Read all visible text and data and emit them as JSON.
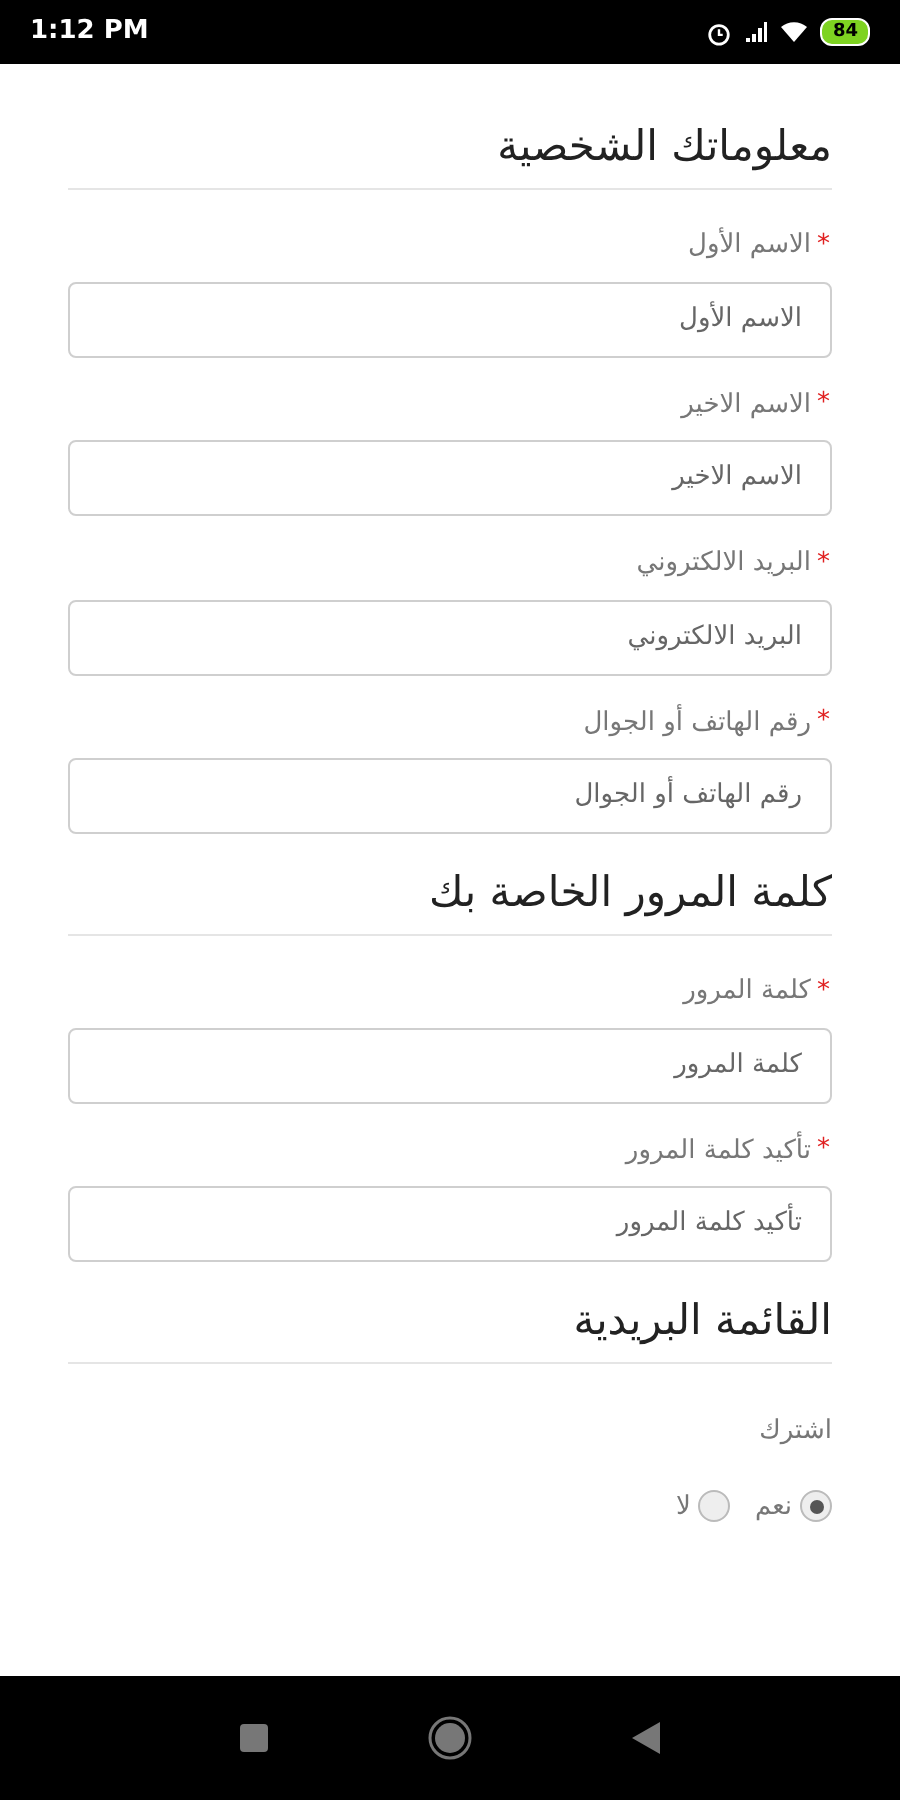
{
  "status_bar": {
    "time": "1:12 PM",
    "battery": "84"
  },
  "sections": [
    {
      "title": "معلوماتك الشخصية",
      "fields": [
        {
          "label": "الاسم الأول",
          "required_mark": "*",
          "placeholder": "الاسم الأول"
        },
        {
          "label": "الاسم الاخير",
          "required_mark": "*",
          "placeholder": "الاسم الاخير"
        },
        {
          "label": "البريد الالكتروني",
          "required_mark": "*",
          "placeholder": "البريد الالكتروني"
        },
        {
          "label": "رقم الهاتف أو الجوال",
          "required_mark": "*",
          "placeholder": "رقم الهاتف أو الجوال"
        }
      ]
    },
    {
      "title": "كلمة المرور الخاصة بك",
      "fields": [
        {
          "label": "كلمة المرور",
          "required_mark": "*",
          "placeholder": "كلمة المرور"
        },
        {
          "label": "تأكيد كلمة المرور",
          "required_mark": "*",
          "placeholder": "تأكيد كلمة المرور"
        }
      ]
    },
    {
      "title": "القائمة البريدية",
      "subscribe": {
        "label": "اشترك",
        "options": [
          {
            "label": "نعم",
            "selected": true
          },
          {
            "label": "لا",
            "selected": false
          }
        ]
      }
    }
  ]
}
